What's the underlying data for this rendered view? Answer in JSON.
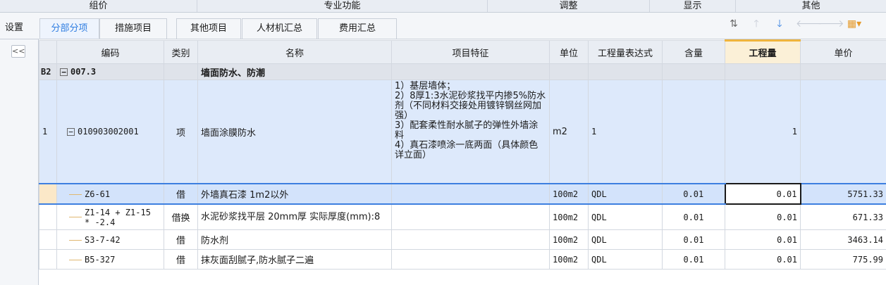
{
  "ribbon": {
    "groups": [
      "组价",
      "专业功能",
      "调整",
      "显示",
      "其他"
    ]
  },
  "toolbar": {
    "settings": "设置",
    "tabs": [
      "分部分项",
      "措施项目",
      "其他项目",
      "人材机汇总",
      "费用汇总"
    ],
    "icons": [
      "sort-icon",
      "move-up-icon",
      "move-down-icon",
      "move-left-icon",
      "move-right-icon",
      "palette-icon"
    ]
  },
  "sidebar": {
    "collapse": "<<"
  },
  "columns": [
    "",
    "编码",
    "类别",
    "名称",
    "项目特征",
    "单位",
    "工程量表达式",
    "含量",
    "工程量",
    "单价"
  ],
  "section": {
    "index": "B2",
    "code": "007.3",
    "name": "墙面防水、防潮"
  },
  "item": {
    "index": "1",
    "code": "010903002001",
    "type": "项",
    "name": "墙面涂膜防水",
    "features": "1）基层墙体；\n2）8厚1:3水泥砂浆找平内掺5%防水剂（不同材料交接处用镀锌钢丝网加强）\n3）配套柔性耐水腻子的弹性外墙涂料\n4）真石漆喷涂一底两面（具体颜色详立面）",
    "unit": "m2",
    "expr": "1",
    "qty": "1"
  },
  "subs": [
    {
      "code": "Z6-61",
      "type": "借",
      "name": "外墙真石漆 1m2以外",
      "unit": "100m2",
      "expr": "QDL",
      "content": "0.01",
      "qty": "0.01",
      "price": "5751.33"
    },
    {
      "code": "Z1-14 + Z1-15 * -2.4",
      "type": "借换",
      "name": "水泥砂浆找平层 20mm厚  实际厚度(mm):8",
      "unit": "100m2",
      "expr": "QDL",
      "content": "0.01",
      "qty": "0.01",
      "price": "671.33"
    },
    {
      "code": "S3-7-42",
      "type": "借",
      "name": "防水剂",
      "unit": "100m2",
      "expr": "QDL",
      "content": "0.01",
      "qty": "0.01",
      "price": "3463.14"
    },
    {
      "code": "B5-327",
      "type": "借",
      "name": "抹灰面刮腻子,防水腻子二遍",
      "unit": "100m2",
      "expr": "QDL",
      "content": "0.01",
      "qty": "0.01",
      "price": "775.99"
    }
  ],
  "colors": {
    "accent": "#2f7de1",
    "selection": "#3d7fe0",
    "highlight_header": "#f0b43c"
  }
}
